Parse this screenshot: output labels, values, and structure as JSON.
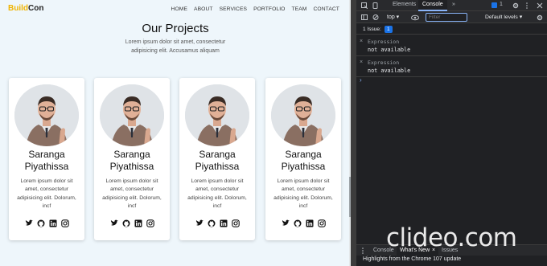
{
  "site": {
    "brand_part1": "Build",
    "brand_part2": "Con",
    "nav": [
      "HOME",
      "ABOUT",
      "SERVICES",
      "PORTFOLIO",
      "TEAM",
      "CONTACT"
    ],
    "section_title": "Our Projects",
    "section_subtitle": "Lorem ipsum dolor sit amet, consectetur adipisicing elit. Accusamus aliquam",
    "cards": [
      {
        "name_line1": "Saranga",
        "name_line2": "Piyathissa",
        "description": "Lorem ipsum dolor sit amet, consectetur adipisicing elit. Dolorum, incf"
      },
      {
        "name_line1": "Saranga",
        "name_line2": "Piyathissa",
        "description": "Lorem ipsum dolor sit amet, consectetur adipisicing elit. Dolorum, incf"
      },
      {
        "name_line1": "Saranga",
        "name_line2": "Piyathissa",
        "description": "Lorem ipsum dolor sit amet, consectetur adipisicing elit. Dolorum, incf"
      },
      {
        "name_line1": "Saranga",
        "name_line2": "Piyathissa",
        "description": "Lorem ipsum dolor sit amet, consectetur adipisicing elit. Dolorum, incf"
      }
    ],
    "social_icons": [
      "twitter-icon",
      "github-icon",
      "linkedin-icon",
      "instagram-icon"
    ],
    "brand_color": "#f0b400"
  },
  "devtools": {
    "tabs": [
      "Elements",
      "Console"
    ],
    "active_tab": "Console",
    "more_tabs": "»",
    "message_count": "1",
    "context": "top ▾",
    "filter_placeholder": "Filter",
    "levels": "Default levels ▾",
    "issues_text": "1 Issue:",
    "issues_count": "1",
    "expressions": [
      {
        "label": "Expression",
        "value": "not available"
      },
      {
        "label": "Expression",
        "value": "not available"
      }
    ],
    "prompt": "›",
    "drawer_tabs": [
      "Console",
      "What's New",
      "Issues"
    ],
    "drawer_active": "What's New",
    "drawer_highlight": "Highlights from the Chrome 107 update",
    "accent_color": "#8ab4f8"
  },
  "watermark": "clideo.com"
}
